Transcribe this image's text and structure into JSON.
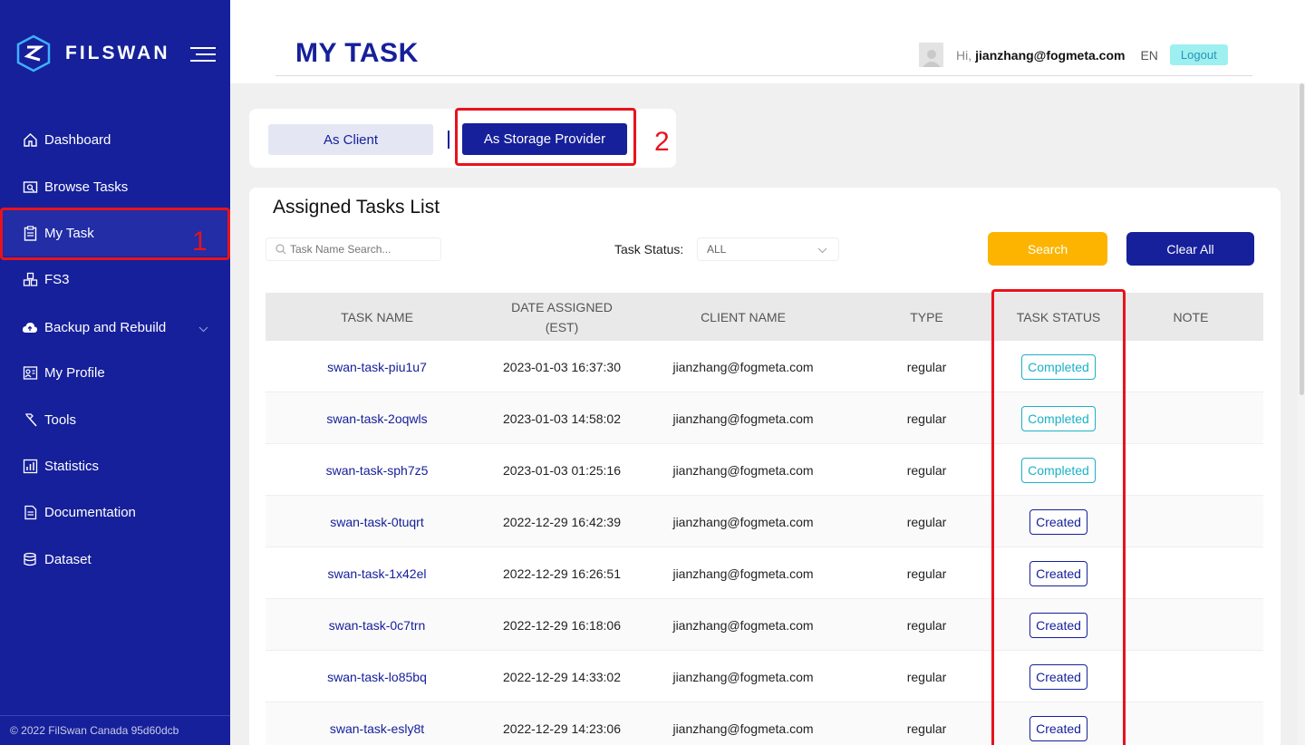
{
  "brand": {
    "name": "FILSWAN"
  },
  "sidebar": {
    "items": [
      {
        "label": "Dashboard",
        "icon": "home-icon"
      },
      {
        "label": "Browse Tasks",
        "icon": "browse-icon"
      },
      {
        "label": "My Task",
        "icon": "clipboard-icon"
      },
      {
        "label": "FS3",
        "icon": "cubes-icon"
      },
      {
        "label": "Backup and Rebuild",
        "icon": "cloud-upload-icon"
      },
      {
        "label": "My Profile",
        "icon": "profile-icon"
      },
      {
        "label": "Tools",
        "icon": "hammer-icon"
      },
      {
        "label": "Statistics",
        "icon": "chart-icon"
      },
      {
        "label": "Documentation",
        "icon": "document-icon"
      },
      {
        "label": "Dataset",
        "icon": "database-icon"
      }
    ],
    "active": "My Task",
    "footer": "© 2022 FilSwan Canada 95d60dcb"
  },
  "header": {
    "title": "MY TASK",
    "greeting": "Hi,",
    "email": "jianzhang@fogmeta.com",
    "lang": "EN",
    "logout": "Logout"
  },
  "tabs": {
    "client": "As Client",
    "provider": "As Storage Provider",
    "active": "As Storage Provider"
  },
  "list": {
    "title": "Assigned Tasks List",
    "search_placeholder": "Task Name Search...",
    "status_label": "Task Status:",
    "status_value": "ALL",
    "search_button": "Search",
    "clear_button": "Clear All"
  },
  "table": {
    "headers": [
      "TASK NAME",
      "DATE ASSIGNED\n(EST)",
      "CLIENT NAME",
      "TYPE",
      "TASK STATUS",
      "NOTE"
    ],
    "rows": [
      {
        "name": "swan-task-piu1u7",
        "date": "2023-01-03 16:37:30",
        "client": "jianzhang@fogmeta.com",
        "type": "regular",
        "status": "Completed",
        "note": ""
      },
      {
        "name": "swan-task-2oqwls",
        "date": "2023-01-03 14:58:02",
        "client": "jianzhang@fogmeta.com",
        "type": "regular",
        "status": "Completed",
        "note": ""
      },
      {
        "name": "swan-task-sph7z5",
        "date": "2023-01-03 01:25:16",
        "client": "jianzhang@fogmeta.com",
        "type": "regular",
        "status": "Completed",
        "note": ""
      },
      {
        "name": "swan-task-0tuqrt",
        "date": "2022-12-29 16:42:39",
        "client": "jianzhang@fogmeta.com",
        "type": "regular",
        "status": "Created",
        "note": ""
      },
      {
        "name": "swan-task-1x42el",
        "date": "2022-12-29 16:26:51",
        "client": "jianzhang@fogmeta.com",
        "type": "regular",
        "status": "Created",
        "note": ""
      },
      {
        "name": "swan-task-0c7trn",
        "date": "2022-12-29 16:18:06",
        "client": "jianzhang@fogmeta.com",
        "type": "regular",
        "status": "Created",
        "note": ""
      },
      {
        "name": "swan-task-lo85bq",
        "date": "2022-12-29 14:33:02",
        "client": "jianzhang@fogmeta.com",
        "type": "regular",
        "status": "Created",
        "note": ""
      },
      {
        "name": "swan-task-esly8t",
        "date": "2022-12-29 14:23:06",
        "client": "jianzhang@fogmeta.com",
        "type": "regular",
        "status": "Created",
        "note": ""
      }
    ]
  },
  "annotations": {
    "one": "1",
    "two": "2"
  },
  "colors": {
    "primary": "#16209a",
    "accent": "#fcb400",
    "completed": "#1ab1c6",
    "annotation": "#e8121c"
  }
}
